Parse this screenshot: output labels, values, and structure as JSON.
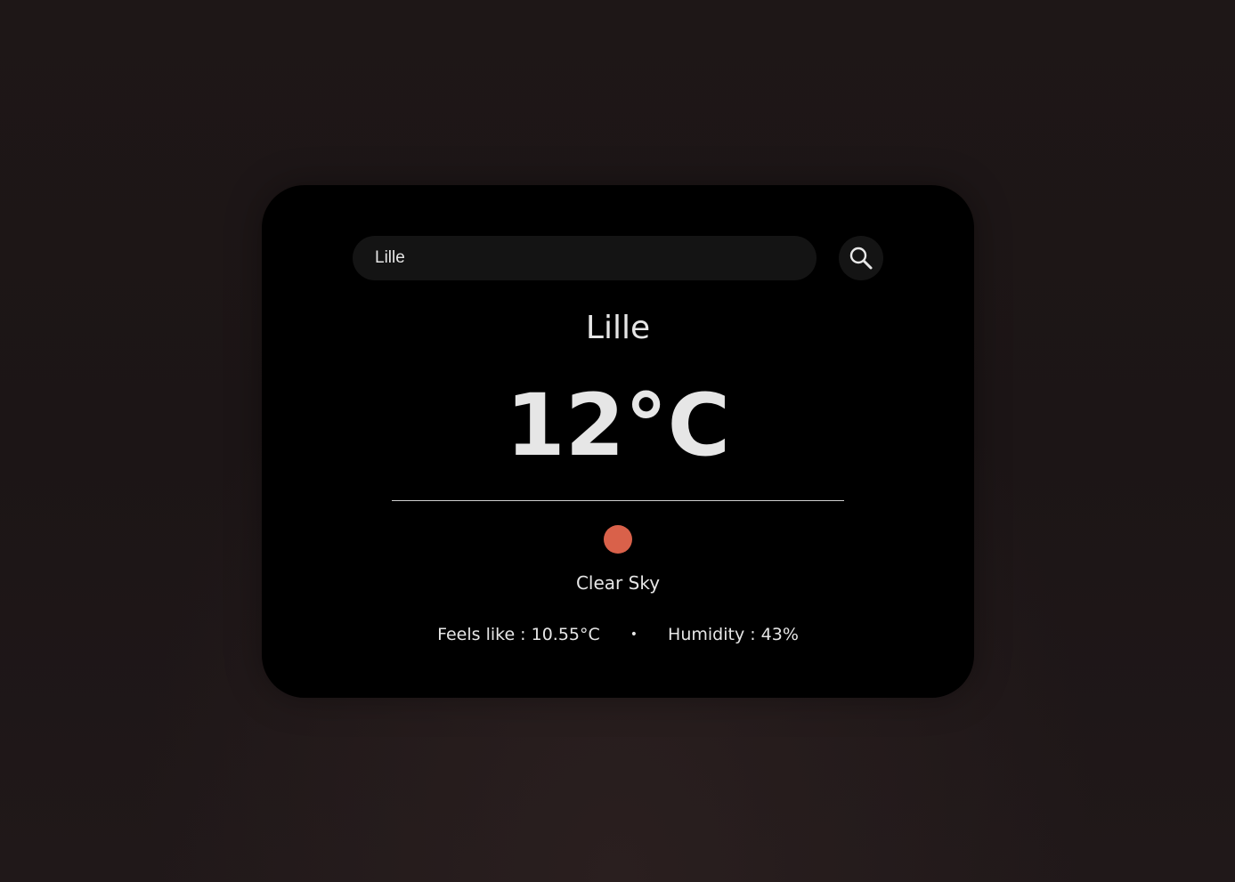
{
  "search": {
    "value": "Lille",
    "button_icon": "search-icon"
  },
  "weather": {
    "city": "Lille",
    "temperature": "12°C",
    "condition": "Clear Sky",
    "condition_icon": "sun-icon",
    "feels_like": "Feels like : 10.55°C",
    "separator": "•",
    "humidity": "Humidity : 43%"
  },
  "colors": {
    "card_background": "#000000",
    "accent_sun": "#d9614a",
    "text": "#e6e6e6"
  }
}
